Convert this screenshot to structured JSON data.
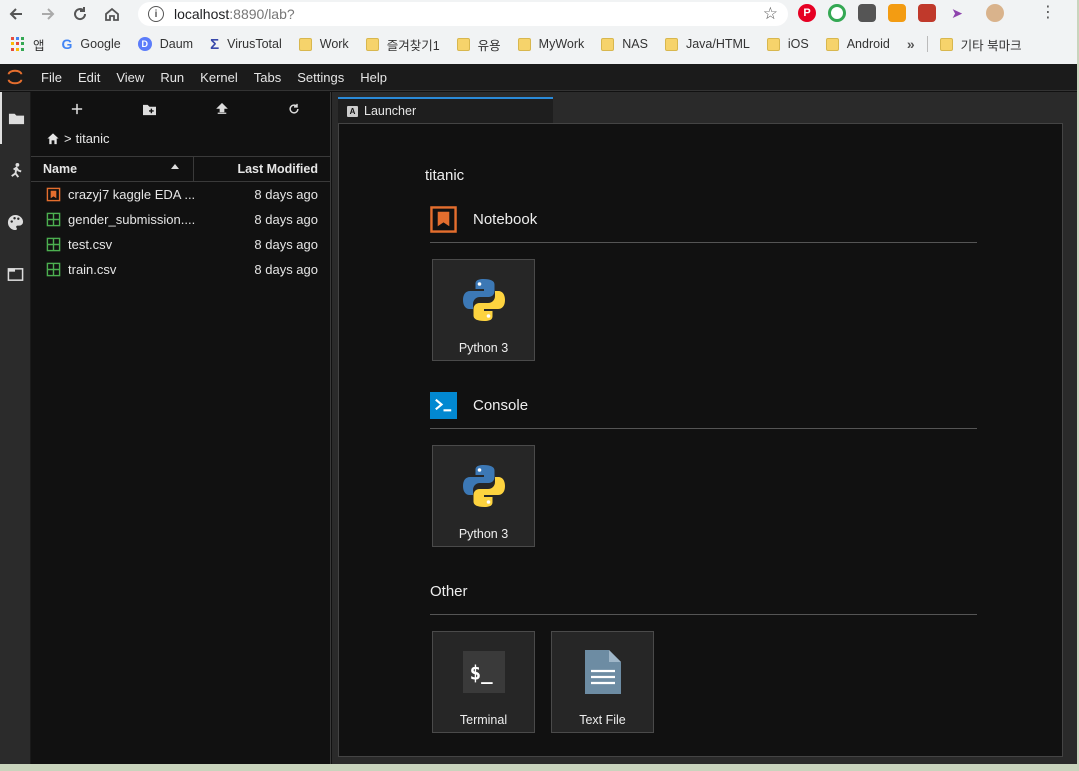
{
  "browser": {
    "url_host": "localhost",
    "url_path": ":8890/lab?",
    "bookmarks": [
      {
        "label": "앱",
        "kind": "apps"
      },
      {
        "label": "Google",
        "kind": "google"
      },
      {
        "label": "Daum",
        "kind": "daum"
      },
      {
        "label": "VirusTotal",
        "kind": "virustotal"
      },
      {
        "label": "Work",
        "kind": "folder"
      },
      {
        "label": "즐겨찾기1",
        "kind": "folder"
      },
      {
        "label": "유용",
        "kind": "folder"
      },
      {
        "label": "MyWork",
        "kind": "folder"
      },
      {
        "label": "NAS",
        "kind": "folder"
      },
      {
        "label": "Java/HTML",
        "kind": "folder"
      },
      {
        "label": "iOS",
        "kind": "folder"
      },
      {
        "label": "Android",
        "kind": "folder"
      }
    ],
    "bookmarks_more": "»",
    "other_bookmarks": "기타 북마크"
  },
  "menubar": {
    "items": [
      "File",
      "Edit",
      "View",
      "Run",
      "Kernel",
      "Tabs",
      "Settings",
      "Help"
    ]
  },
  "filebrowser": {
    "breadcrumb": "titanic",
    "breadcrumb_sep": ">",
    "col_name": "Name",
    "col_modified": "Last Modified",
    "files": [
      {
        "name": "crazyj7 kaggle EDA ...",
        "modified": "8 days ago",
        "type": "notebook"
      },
      {
        "name": "gender_submission....",
        "modified": "8 days ago",
        "type": "csv"
      },
      {
        "name": "test.csv",
        "modified": "8 days ago",
        "type": "csv"
      },
      {
        "name": "train.csv",
        "modified": "8 days ago",
        "type": "csv"
      }
    ]
  },
  "tabs": {
    "launcher_label": "Launcher",
    "launcher_icon_glyph": "A"
  },
  "launcher": {
    "cwd": "titanic",
    "sections": {
      "notebook": {
        "title": "Notebook",
        "cards": [
          "Python 3"
        ]
      },
      "console": {
        "title": "Console",
        "cards": [
          "Python 3"
        ]
      },
      "other": {
        "title": "Other",
        "cards": [
          "Terminal",
          "Text File"
        ]
      }
    },
    "terminal_glyph": "$_"
  },
  "colors": {
    "notebook_orange": "#e46e2e",
    "csv_green": "#4caf50",
    "console_blue": "#0288d1",
    "tab_accent": "#2a8ad8"
  }
}
